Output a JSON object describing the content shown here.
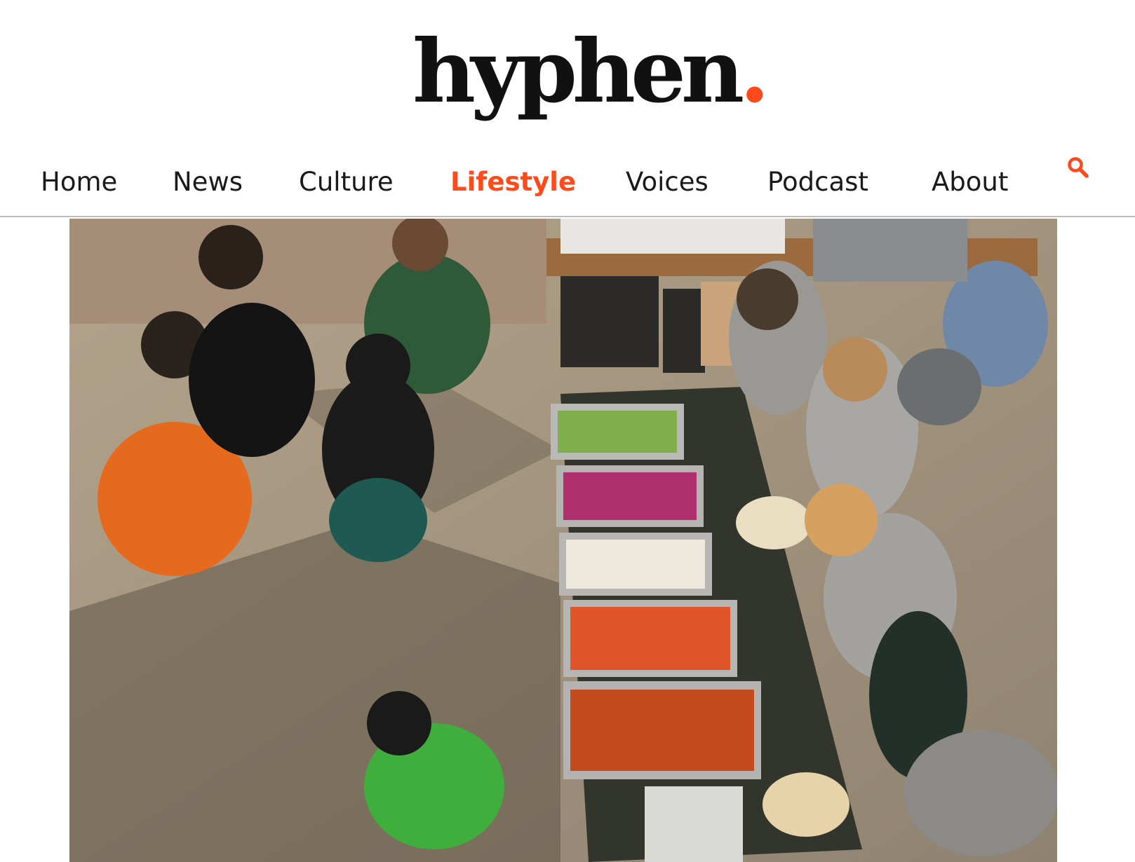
{
  "site": {
    "logo_text": "hyphen",
    "logo_dot": "."
  },
  "nav": {
    "items": [
      {
        "label": "Home",
        "active": false
      },
      {
        "label": "News",
        "active": false
      },
      {
        "label": "Culture",
        "active": false
      },
      {
        "label": "Lifestyle",
        "active": true
      },
      {
        "label": "Voices",
        "active": false
      },
      {
        "label": "Podcast",
        "active": false
      },
      {
        "label": "About",
        "active": false
      }
    ],
    "search_icon": "search-icon"
  },
  "colors": {
    "accent": "#ff4a1c",
    "text": "#1a1a1a",
    "divider": "#bdbdbd"
  },
  "hero": {
    "image": "photo-food-serving-outdoors"
  }
}
